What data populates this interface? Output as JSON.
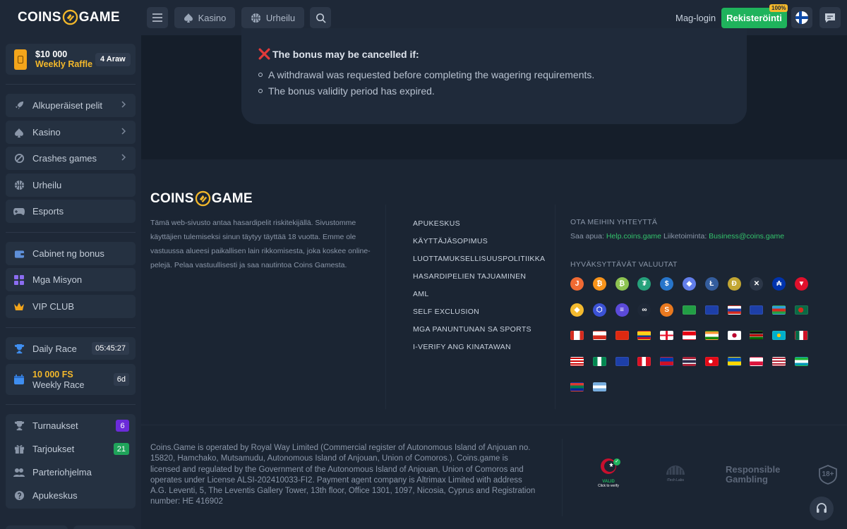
{
  "header": {
    "brand_left": "COINS",
    "brand_right": "GAME",
    "nav": [
      {
        "label": "Kasino"
      },
      {
        "label": "Urheilu"
      }
    ],
    "login_label": "Mag-login",
    "register_label": "Rekisteröinti",
    "register_badge": "100%"
  },
  "sidebar": {
    "raffle": {
      "amount": "$10 000",
      "title": "Weekly Raffle",
      "tag": "4 Araw"
    },
    "group1": [
      {
        "label": "Alkuperäiset pelit",
        "icon": "rocket-icon"
      },
      {
        "label": "Kasino",
        "icon": "spade-icon"
      },
      {
        "label": "Crashes games",
        "icon": "crash-icon"
      },
      {
        "label": "Urheilu",
        "icon": "basketball-icon"
      },
      {
        "label": "Esports",
        "icon": "gamepad-icon"
      }
    ],
    "group2": [
      {
        "label": "Cabinet ng bonus",
        "icon": "wallet-icon"
      },
      {
        "label": "Mga Misyon",
        "icon": "grid-icon"
      },
      {
        "label": "VIP CLUB",
        "icon": "crown-icon"
      }
    ],
    "daily_race": {
      "label": "Daily Race",
      "timer": "05:45:27"
    },
    "weekly_race": {
      "amount": "10 000 FS",
      "title": "Weekly Race",
      "tag": "6d"
    },
    "group3": [
      {
        "label": "Turnaukset",
        "icon": "trophy-icon",
        "badge": "6",
        "badge_color": "#6b2bd9"
      },
      {
        "label": "Tarjoukset",
        "icon": "gift-icon",
        "badge": "21",
        "badge_color": "#1fa35a"
      },
      {
        "label": "Parteriohjelma",
        "icon": "people-icon"
      },
      {
        "label": "Apukeskus",
        "icon": "help-icon"
      }
    ]
  },
  "bonus": {
    "heading": "The bonus may be cancelled if:",
    "items": [
      "A withdrawal was requested before completing the wagering requirements.",
      "The bonus validity period has expired."
    ]
  },
  "footer": {
    "brand_left": "COINS",
    "brand_right": "GAME",
    "disclaimer": "Tämä web-sivusto antaa hasardipelit riskitekijällä. Sivustomme käyttäjien tulemiseksi sinun täytyy täyttää 18 vuotta. Emme ole vastuussa alueesi paikallisen lain rikkomisesta, joka koskee online-pelejä. Pelaa vastuullisesti ja saa nautintoa Coins Gamesta.",
    "links": [
      "APUKESKUS",
      "KÄYTTÄJÄSOPIMUS",
      "LUOTTAMUKSELLISUUSPOLITIIKKA",
      "HASARDIPELIEN TAJUAMINEN",
      "AML",
      "SELF EXCLUSION",
      "MGA PANUNTUNAN SA SPORTS",
      "I-VERIFY ANG KINATAWAN"
    ],
    "contact_heading": "OTA MEIHIN YHTEYTTÄ",
    "help_label": "Saa apua:",
    "help_email": "Help.coins.game",
    "business_label": "Liiketoiminta:",
    "business_email": "Business@coins.game",
    "currencies_heading": "HYVÄKSYTTÄVÄT VALUUTAT",
    "coins": [
      {
        "name": "coins-game-coin-icon",
        "color": "#f06a33",
        "glyph": "J"
      },
      {
        "name": "bitcoin-icon",
        "color": "#f7931a",
        "glyph": "₿"
      },
      {
        "name": "bitcoin-cash-icon",
        "color": "#8dc351",
        "glyph": "₿"
      },
      {
        "name": "tether-icon",
        "color": "#26a17b",
        "glyph": "₮"
      },
      {
        "name": "usdc-icon",
        "color": "#2775ca",
        "glyph": "$"
      },
      {
        "name": "ethereum-icon",
        "color": "#627eea",
        "glyph": "◆"
      },
      {
        "name": "litecoin-icon",
        "color": "#345d9d",
        "glyph": "Ł"
      },
      {
        "name": "dogecoin-icon",
        "color": "#c2a633",
        "glyph": "Ð"
      },
      {
        "name": "ripple-icon",
        "color": "#2c3748",
        "glyph": "✕"
      },
      {
        "name": "cardano-icon",
        "color": "#0033ad",
        "glyph": "₳"
      },
      {
        "name": "tron-icon",
        "color": "#e0102c",
        "glyph": "▼"
      },
      {
        "name": "bnb-icon",
        "color": "#f3ba2f",
        "glyph": "◆"
      },
      {
        "name": "cronos-icon",
        "color": "#3b52d6",
        "glyph": "⬡"
      },
      {
        "name": "solana-icon",
        "color": "#5b4ad9",
        "glyph": "≡"
      },
      {
        "name": "polygon-icon",
        "color": "#1e2837",
        "glyph": "∞"
      },
      {
        "name": "shiba-icon",
        "color": "#e9791f",
        "glyph": "S"
      }
    ],
    "flags": [
      "brazil-flag-icon",
      "eu-flag-icon",
      "russia-flag-icon",
      "australia-flag-icon",
      "azerbaijan-flag-icon",
      "bangladesh-flag-icon",
      "canada-flag-icon",
      "chile-flag-icon",
      "china-flag-icon",
      "colombia-flag-icon",
      "georgia-flag-icon",
      "indonesia-flag-icon",
      "india-flag-icon",
      "japan-flag-icon",
      "kenya-flag-icon",
      "kazakhstan-flag-icon",
      "mexico-flag-icon",
      "malaysia-flag-icon",
      "nigeria-flag-icon",
      "new-zealand-flag-icon",
      "peru-flag-icon",
      "philippines-flag-icon",
      "thailand-flag-icon",
      "turkey-flag-icon",
      "ukraine-flag-icon",
      "poland-flag-icon",
      "usa-flag-icon",
      "uzbekistan-flag-icon",
      "south-africa-flag-icon",
      "argentina-flag-icon"
    ],
    "legal": "Coins.Game is operated by Royal Way Limited (Commercial register of Autonomous Island of Anjouan no. 15820, Hamchako, Mutsamudu, Autonomous Island of Anjouan, Union of Comoros.). Coins.game is licensed and regulated by the Government of the Autonomous Island of Anjouan, Union of Comoros and operates under License ALSI-202410033-FI2. Payment agent company is Altrimax Limited with address A.G. Leventi, 5, The Leventis Gallery Tower, 13th floor, Office 1301, 1097, Nicosia, Cyprus and Registration number: HE 416902",
    "seal_valid": "VALID",
    "seal_click": "Click to verify",
    "itech_label": "iTech Labs",
    "responsible": "Responsible Gambling",
    "age_label": "18+"
  }
}
